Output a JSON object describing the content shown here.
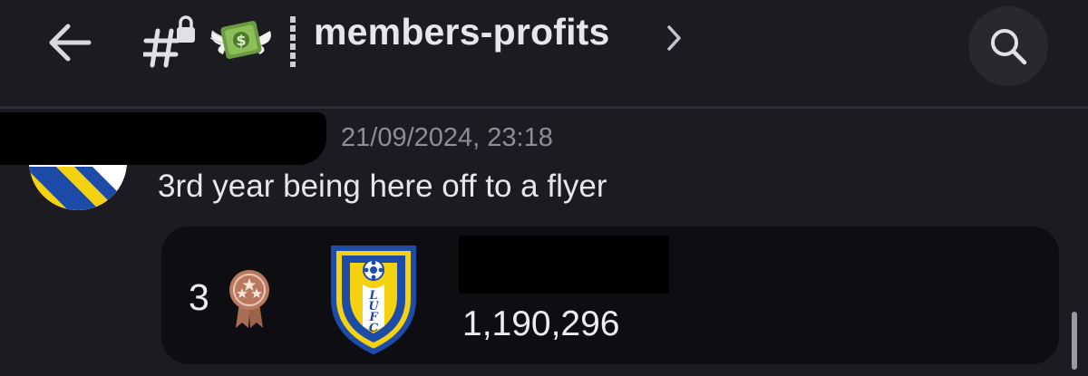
{
  "header": {
    "channel_name": "members-profits",
    "icons": {
      "back": "arrow-left-icon",
      "channel": "hash-lock-icon",
      "emoji": "money-with-wings-icon",
      "divider": "vertical-divider-icon",
      "chevron": "chevron-right-icon",
      "search": "search-icon"
    }
  },
  "message": {
    "timestamp": "21/09/2024, 23:18",
    "text": "3rd year being here off to a flyer"
  },
  "embed": {
    "rank": "3",
    "medal_icon": "bronze-medal-icon",
    "crest_icon": "leeds-united-crest-icon",
    "crest_text": "LUFC",
    "score": "1,190,296"
  },
  "colors": {
    "background": "#1b1b21",
    "card": "#0e0e12",
    "muted_text": "#8d8d97",
    "medal": "#b87a5e",
    "crest_blue": "#1d4ba8",
    "crest_yellow": "#f4d20f"
  }
}
